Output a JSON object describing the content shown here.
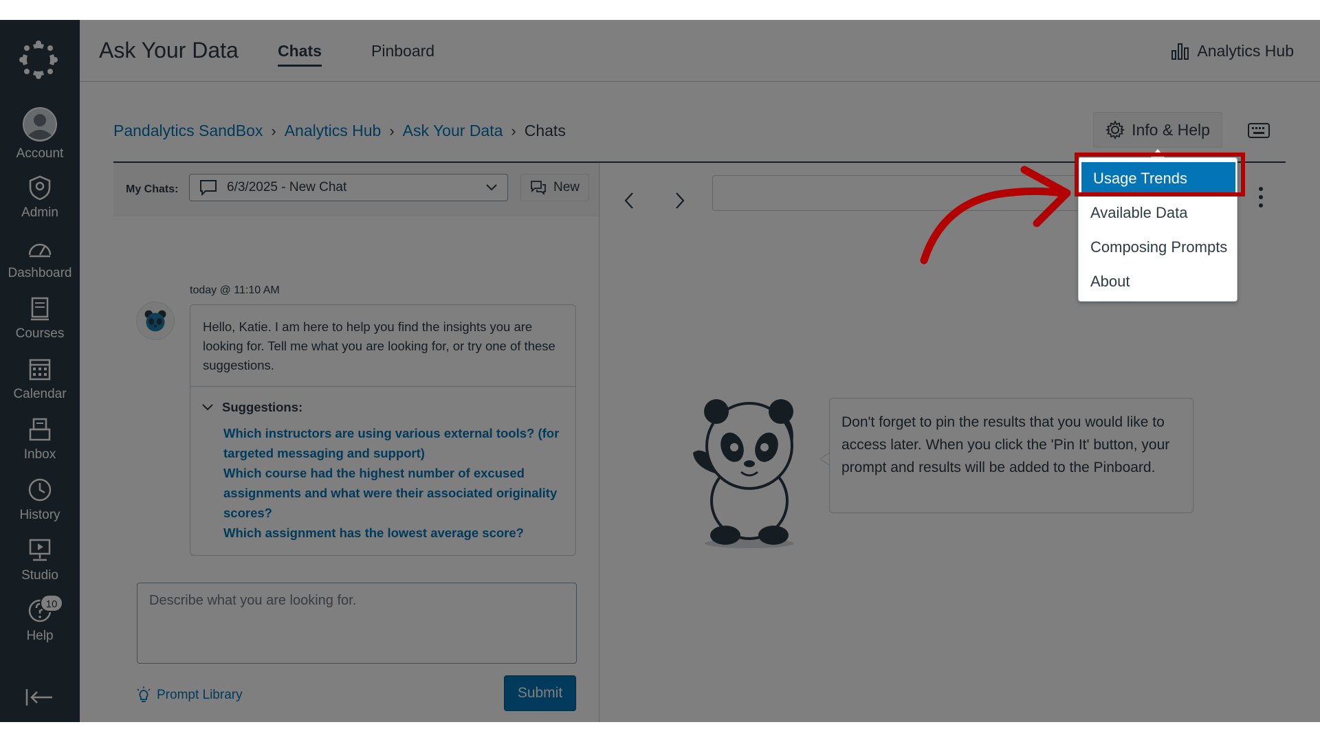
{
  "nav": {
    "items": [
      {
        "label": "Account",
        "icon": "account-icon"
      },
      {
        "label": "Admin",
        "icon": "admin-icon"
      },
      {
        "label": "Dashboard",
        "icon": "dashboard-icon"
      },
      {
        "label": "Courses",
        "icon": "courses-icon"
      },
      {
        "label": "Calendar",
        "icon": "calendar-icon"
      },
      {
        "label": "Inbox",
        "icon": "inbox-icon"
      },
      {
        "label": "History",
        "icon": "history-icon"
      },
      {
        "label": "Studio",
        "icon": "studio-icon"
      },
      {
        "label": "Help",
        "icon": "help-icon",
        "badge": "10"
      }
    ]
  },
  "header": {
    "title": "Ask Your Data",
    "tabs": [
      {
        "label": "Chats",
        "active": true
      },
      {
        "label": "Pinboard",
        "active": false
      }
    ],
    "hub_link": "Analytics Hub"
  },
  "breadcrumb": [
    "Pandalytics SandBox",
    "Analytics Hub",
    "Ask Your Data",
    "Chats"
  ],
  "info_button": "Info & Help",
  "menu": {
    "items": [
      "Usage Trends",
      "Available Data",
      "Composing Prompts",
      "About"
    ],
    "selected": "Usage Trends"
  },
  "chat": {
    "my_chats_label": "My Chats:",
    "selected_chat": "6/3/2025 - New Chat",
    "new_button": "New",
    "timestamp": "today @ 11:10 AM",
    "greeting": "Hello, Katie. I am here to help you find the insights you are looking for. Tell me what you are looking for, or try one of these suggestions.",
    "suggestions_label": "Suggestions:",
    "suggestions": [
      "Which instructors are using various external tools? (for targeted messaging and support)",
      "Which course had the highest number of excused assignments and what were their associated originality scores?",
      "Which assignment has the lowest average score?"
    ],
    "prompt_placeholder": "Describe what you are looking for.",
    "prompt_library": "Prompt Library",
    "submit": "Submit"
  },
  "tip": "Don't forget to pin the results that you would like to access later. When you click the 'Pin It' button, your prompt and results will be added to the Pinboard.",
  "colors": {
    "nav_bg": "#2d3b45",
    "link": "#0374b5",
    "annotation": "#b30000"
  }
}
